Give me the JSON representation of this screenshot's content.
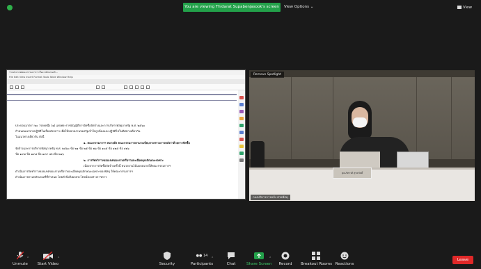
{
  "top_bar": {
    "banner": "You are viewing Thidarat Supabenjasook's screen",
    "view_options": "View Options ⌄",
    "view": "View"
  },
  "shared_doc": {
    "title_text": "ร่างประกาศคณะกรรมการฯ เรื่อง หลักเกณฑ์...",
    "menu_text": "File  Edit  View  Insert  Format  Tools  Table  Window  Help",
    "tabs": [
      "หน้าแรก",
      "แทรก",
      "การออกแบบ",
      "เค้าโครง",
      "การอ้างอิง",
      "การส่งจดหมาย",
      "ตรวจทาน"
    ],
    "lines": [
      "ประกอบมาตรา ๒๐ วรรคหนึ่ง (๑) แห่งพระราชบัญญัติการจัดซื้อจัดจ้างและการบริหารพัสดุภาครัฐ พ.ศ. ๒๕๖๐",
      "กำหนดแนวทางปฏิบัติในเรื่องดังกล่าว เพื่อให้หน่วยงานของรัฐเข้าใจถูกต้องและปฏิบัติไปในทิศทางเดียวกัน",
      "ในแนวทางเดียวกัน ดังนี้",
      "๑. คณะกรรมการฯ หมายถึง คณะกรรมการตามระเบียบกระทรวงการคลังว่าด้วยการจัดซื้อ",
      "จัดจ้างและการบริหารพัสดุภาครัฐ พ.ศ. ๒๕๖๐ ข้อ ๒๑ ข้อ ๒๕ ข้อ ๒๖ ข้อ ๑๐๕ ข้อ ๑๒๕ ข้อ ๑๒๖",
      "ข้อ ๑๙๗ ข้อ ๑๙๘ ข้อ ๑๙๙ และข้อ ๒๑๖",
      "๒. การจัดทำร่างขอบเขตของงานหรือรายละเอียดคุณลักษณะเฉพาะ",
      "เนื่องจากการจัดซื้อจัดจ้างครั้งนี้ หน่วยงานได้มอบหมายให้คณะกรรมการฯ",
      "ดำเนินการจัดทำร่างขอบเขตของงานหรือรายละเอียดคุณลักษณะเฉพาะของพัสดุ ให้คณะกรรมการฯ",
      "ดำเนินการตามหลักเกณฑ์ที่กำหนด โดยคำนึงถึงผลประโยชน์ของทางราชการ"
    ]
  },
  "video": {
    "spotlight_label": "Remove Spotlight",
    "nameplate": "คุณภัทรวดี สุขสวัสดิ์",
    "participant_name": "กองบริหารการคลัง ฝ่ายพัสดุ"
  },
  "toolbar": {
    "unmute": "Unmute",
    "start_video": "Start Video",
    "security": "Security",
    "participants": "Participants",
    "participants_count": "14",
    "chat": "Chat",
    "share_screen": "Share Screen",
    "record": "Record",
    "breakout_rooms": "Breakout Rooms",
    "reactions": "Reactions",
    "leave": "Leave"
  },
  "colors": {
    "banner_green": "#23a14a",
    "leave_red": "#e02828",
    "share_green": "#23a14a"
  }
}
